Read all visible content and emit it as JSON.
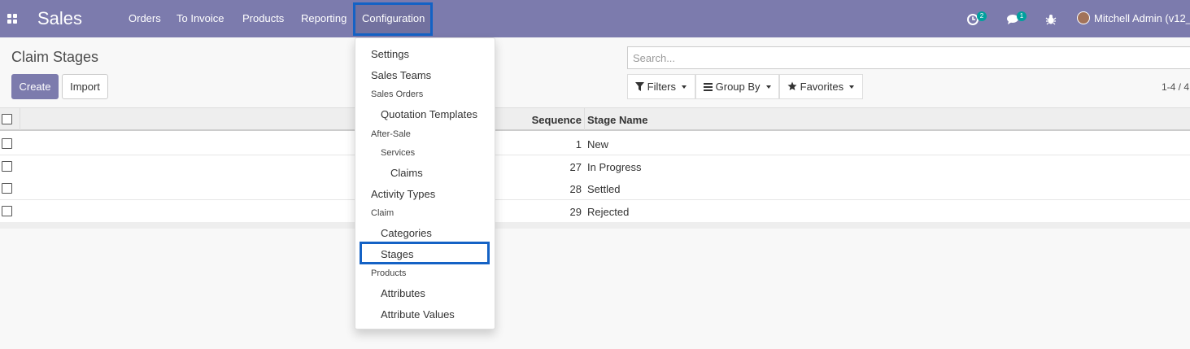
{
  "navbar": {
    "app_name": "Sales",
    "menu": [
      "Orders",
      "To Invoice",
      "Products",
      "Reporting",
      "Configuration"
    ],
    "activity_count": "2",
    "message_count": "1",
    "user_name": "Mitchell Admin (v12_",
    "color": "#7c7bad"
  },
  "control_panel": {
    "breadcrumb": "Claim Stages",
    "create_label": "Create",
    "import_label": "Import",
    "search_placeholder": "Search...",
    "filters_label": "Filters",
    "group_by_label": "Group By",
    "favorites_label": "Favorites",
    "pager": "1-4 / 4"
  },
  "list": {
    "columns": [
      "Sequence",
      "Stage Name"
    ],
    "rows": [
      {
        "sequence": "1",
        "name": "New"
      },
      {
        "sequence": "27",
        "name": "In Progress"
      },
      {
        "sequence": "28",
        "name": "Settled"
      },
      {
        "sequence": "29",
        "name": "Rejected"
      }
    ]
  },
  "config_menu": {
    "settings": "Settings",
    "sales_teams": "Sales Teams",
    "sales_orders_header": "Sales Orders",
    "quotation_templates": "Quotation Templates",
    "after_sale_header": "After-Sale",
    "services_header": "Services",
    "claims": "Claims",
    "activity_types": "Activity Types",
    "claim_header": "Claim",
    "categories": "Categories",
    "stages": "Stages",
    "products_header": "Products",
    "attributes": "Attributes",
    "attribute_values": "Attribute Values"
  },
  "icons": {
    "apps": "apps-grid-icon",
    "activity": "clock-icon",
    "messages": "chat-bubble-icon",
    "debug": "bug-icon",
    "filter": "filter-icon",
    "group_by": "bars-icon",
    "favorites": "star-icon"
  }
}
